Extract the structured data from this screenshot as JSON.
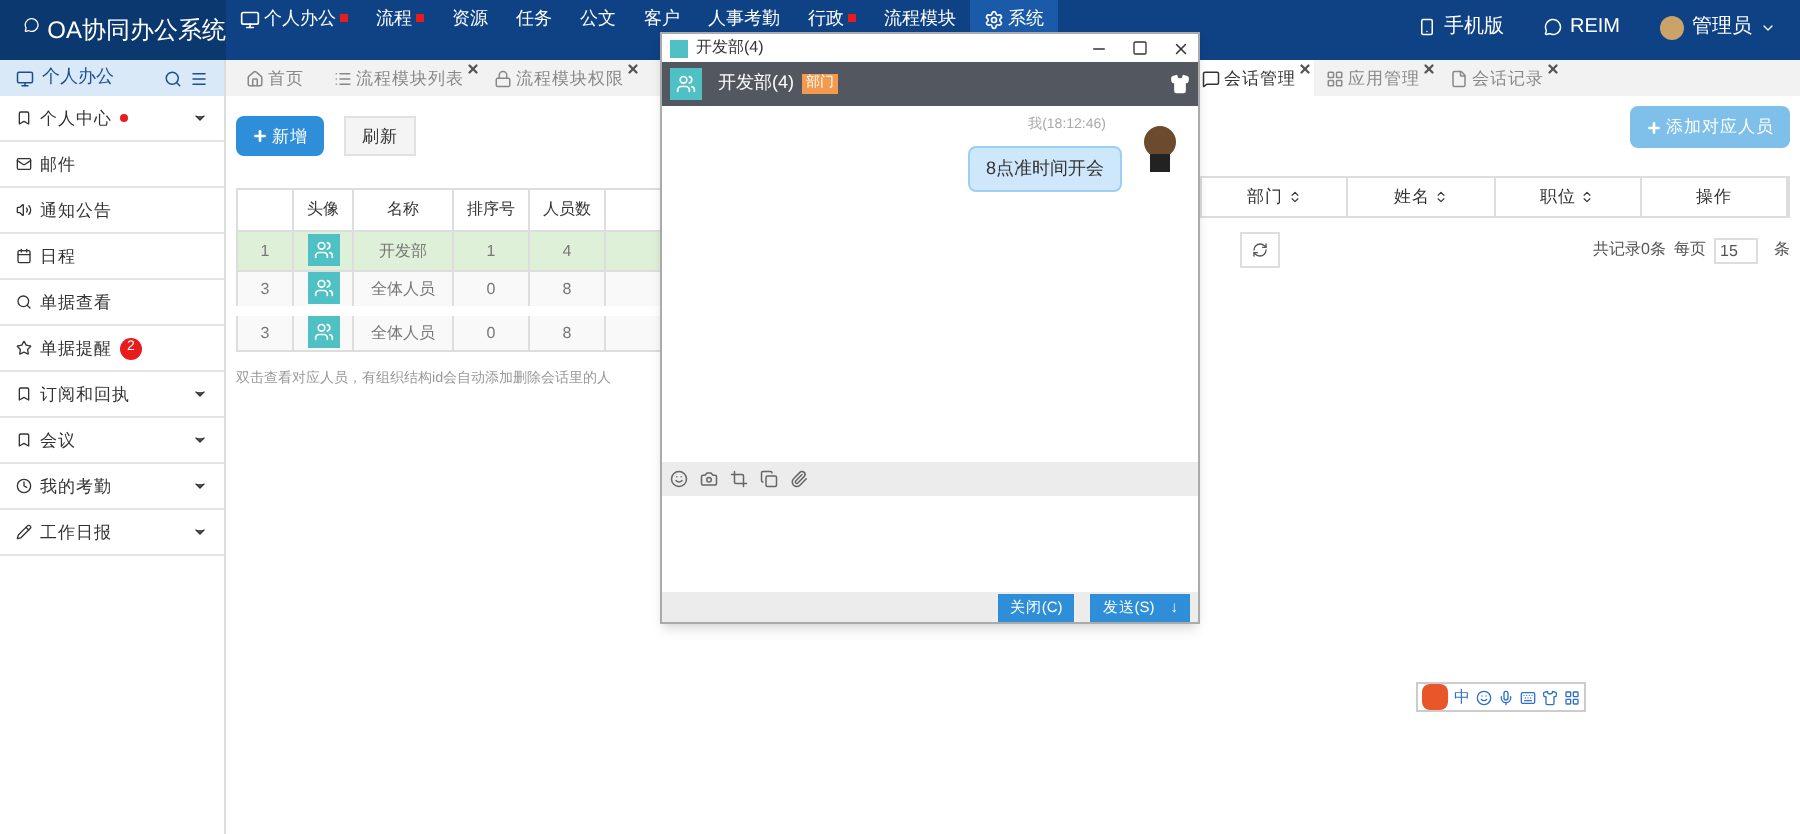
{
  "app": {
    "title": "OA协同办公系统"
  },
  "top_nav": [
    {
      "label": "个人办公",
      "dot": true,
      "selected": false
    },
    {
      "label": "流程",
      "dot": true,
      "selected": false
    },
    {
      "label": "资源",
      "dot": false,
      "selected": false
    },
    {
      "label": "任务",
      "dot": false,
      "selected": false
    },
    {
      "label": "公文",
      "dot": false,
      "selected": false
    },
    {
      "label": "客户",
      "dot": false,
      "selected": false
    },
    {
      "label": "人事考勤",
      "dot": false,
      "selected": false
    },
    {
      "label": "行政",
      "dot": true,
      "selected": false
    },
    {
      "label": "流程模块",
      "dot": false,
      "selected": false
    },
    {
      "label": "系统",
      "dot": false,
      "selected": true
    }
  ],
  "top_right": [
    "手机版",
    "REIM",
    "管理员"
  ],
  "sidebar": {
    "title": "个人办公",
    "items": [
      {
        "label": "个人中心",
        "dot": true,
        "expandable": true
      },
      {
        "label": "邮件",
        "dot": false,
        "expandable": false
      },
      {
        "label": "通知公告",
        "dot": false,
        "expandable": false
      },
      {
        "label": "日程",
        "dot": false,
        "expandable": false
      },
      {
        "label": "单据查看",
        "dot": false,
        "expandable": false
      },
      {
        "label": "单据提醒",
        "dot": false,
        "badge": "2",
        "expandable": false
      },
      {
        "label": "订阅和回执",
        "dot": false,
        "expandable": true
      },
      {
        "label": "会议",
        "dot": false,
        "expandable": true
      },
      {
        "label": "我的考勤",
        "dot": false,
        "expandable": true
      },
      {
        "label": "工作日报",
        "dot": false,
        "expandable": true
      }
    ]
  },
  "tabs_left": [
    {
      "label": "首页",
      "closable": false,
      "selected": false
    },
    {
      "label": "流程模块列表",
      "closable": true,
      "selected": false
    },
    {
      "label": "流程模块权限",
      "closable": true,
      "selected": false
    }
  ],
  "tabs_right": [
    {
      "label": "会话管理",
      "closable": true,
      "selected": true
    },
    {
      "label": "应用管理",
      "closable": true,
      "selected": false
    },
    {
      "label": "会话记录",
      "closable": true,
      "selected": false
    }
  ],
  "left_panel": {
    "buttons": [
      "新增",
      "刷新"
    ],
    "columns": [
      "头像",
      "名称",
      "排序号",
      "人员数"
    ],
    "rows": [
      {
        "index": "1",
        "name": "开发部",
        "order": "1",
        "count": "4",
        "selected": true
      },
      {
        "index": "3",
        "name": "全体人员",
        "order": "0",
        "count": "8",
        "selected": false
      },
      {
        "index": "3",
        "name": "全体人员",
        "order": "0",
        "count": "8",
        "selected": false
      }
    ],
    "hint": "双击查看对应人员，有组织结构id会自动添加删除会话里的人"
  },
  "right_panel": {
    "add_button": "添加对应人员",
    "columns": [
      "部门",
      "姓名",
      "职位",
      "操作"
    ],
    "total": "共记录0条",
    "per_page_label": "每页",
    "per_page": "15",
    "per_page_unit": "条"
  },
  "chat_window": {
    "title": "开发部(4)",
    "group": "开发部(4)",
    "tag": "部门",
    "messages": [
      {
        "sender_time": "我(18:12:46)",
        "text": "8点准时间开会"
      }
    ],
    "buttons": [
      "关闭(C)",
      "发送(S)"
    ],
    "send_menu": "↓"
  },
  "ime_bar": {
    "mode": "中"
  }
}
